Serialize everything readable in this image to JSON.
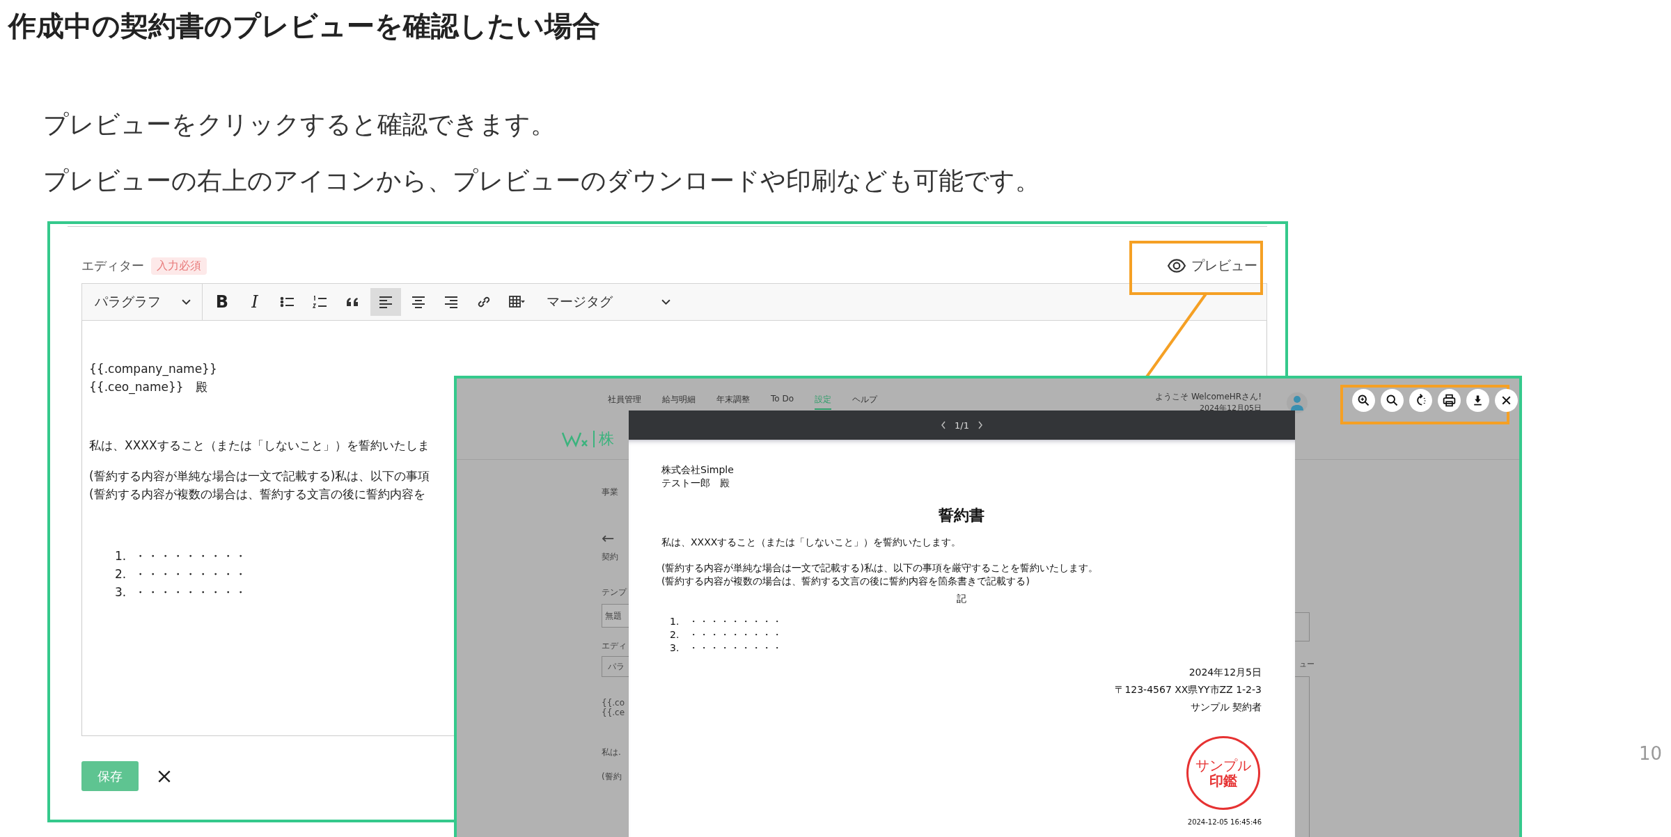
{
  "slide": {
    "title": "作成中の契約書のプレビューを確認したい場合",
    "lines": [
      "プレビューをクリックすると確認できます。",
      "プレビューの右上のアイコンから、プレビューのダウンロードや印刷なども可能です。"
    ],
    "page_number": "10"
  },
  "editor": {
    "label": "エディター",
    "required_badge": "入力必須",
    "preview_button": "プレビュー",
    "toolbar": {
      "paragraph_select": "パラグラフ",
      "tools": [
        {
          "kind": "bold",
          "label": "B",
          "selected": false
        },
        {
          "kind": "italic",
          "label": "I",
          "selected": false
        },
        {
          "kind": "bullet_list",
          "selected": false
        },
        {
          "kind": "numbered_list",
          "selected": false
        },
        {
          "kind": "quote",
          "selected": false
        },
        {
          "kind": "align_left",
          "selected": true
        },
        {
          "kind": "align_center",
          "selected": false
        },
        {
          "kind": "align_right",
          "selected": false
        },
        {
          "kind": "link",
          "selected": false
        },
        {
          "kind": "table",
          "selected": false
        }
      ],
      "merge_tag_select": "マージタグ"
    },
    "content": {
      "address_lines": [
        "{{.company_name}}",
        "{{.ceo_name}}　殿"
      ],
      "pledge": "私は、XXXXすること（または「しないこと」）を誓約いたしま",
      "conditions": [
        "(誓約する内容が単純な場合は一文で記載する)私は、以下の事項",
        "(誓約する内容が複数の場合は、誓約する文言の後に誓約内容を"
      ],
      "list": [
        {
          "marker": "1.",
          "text": "・・・・・・・・・"
        },
        {
          "marker": "2.",
          "text": "・・・・・・・・・"
        },
        {
          "marker": "3.",
          "text": "・・・・・・・・・"
        }
      ]
    },
    "save_button": "保存"
  },
  "preview_screen": {
    "nav": [
      {
        "label": "社員管理",
        "selected": false
      },
      {
        "label": "給与明細",
        "selected": false
      },
      {
        "label": "年末調整",
        "selected": false
      },
      {
        "label": "To Do",
        "selected": false
      },
      {
        "label": "設定",
        "selected": true
      },
      {
        "label": "ヘルプ",
        "selected": false
      }
    ],
    "company_fragment": "株",
    "greeting": "ようこそ WelcomeHRさん!",
    "date": "2024年12月05日",
    "background_fragments": [
      {
        "kind": "crumb",
        "text": "事業"
      },
      {
        "kind": "back",
        "text": "←"
      },
      {
        "kind": "heading",
        "text": "契約"
      },
      {
        "kind": "label",
        "text": "テンプ"
      },
      {
        "kind": "input",
        "text": "無題"
      },
      {
        "kind": "label",
        "text": "エディ"
      },
      {
        "kind": "toolbar",
        "text": "パラ"
      },
      {
        "kind": "code",
        "text": "{{.co"
      },
      {
        "kind": "code",
        "text": "{{.ce"
      },
      {
        "kind": "body",
        "text": "私は."
      },
      {
        "kind": "body",
        "text": "(誓約"
      }
    ],
    "right_fragment": "ュー",
    "viewer": {
      "page_indicator": "1/1",
      "document": {
        "recipient_lines": [
          "株式会社Simple",
          "テスト一郎　殿"
        ],
        "title": "誓約書",
        "pledge": "私は、XXXXすること（または「しないこと」）を誓約いたします。",
        "conditions": [
          "(誓約する内容が単純な場合は一文で記載する)私は、以下の事項を厳守することを誓約いたします。",
          "(誓約する内容が複数の場合は、誓約する文言の後に誓約内容を箇条書きで記載する)"
        ],
        "note": "記",
        "list": [
          {
            "marker": "1.",
            "text": "・・・・・・・・・"
          },
          {
            "marker": "2.",
            "text": "・・・・・・・・・"
          },
          {
            "marker": "3.",
            "text": "・・・・・・・・・"
          }
        ],
        "date": "2024年12月5日",
        "address": "〒123-4567 XX県YY市ZZ 1-2-3",
        "signer": "サンプル 契約者",
        "stamp": [
          "サンプル",
          "印鑑"
        ],
        "timestamp": "2024-12-05 16:45:46"
      }
    },
    "actions": [
      {
        "kind": "zoom_in"
      },
      {
        "kind": "zoom_out"
      },
      {
        "kind": "rotate"
      },
      {
        "kind": "print"
      },
      {
        "kind": "download"
      },
      {
        "kind": "close"
      }
    ]
  }
}
